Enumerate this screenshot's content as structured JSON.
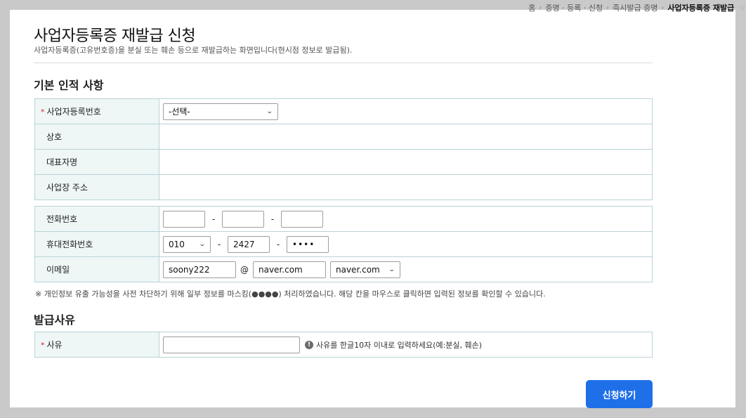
{
  "breadcrumb": {
    "home": "홈",
    "level1": "증명 · 등록 · 신청",
    "level2": "즉시발급 증명",
    "current": "사업자등록증 재발급"
  },
  "page": {
    "title": "사업자등록증 재발급 신청",
    "description": "사업자등록증(고유번호증)을 분실 또는 훼손 등으로 재발급하는 화면입니다(현시점 정보로 발급됨)."
  },
  "basic_info": {
    "section_title": "기본 인적 사항",
    "reg_number_label": "사업자등록번호",
    "reg_number_value": "-선택-",
    "company_label": "상호",
    "company_value": "",
    "ceo_label": "대표자명",
    "ceo_value": "",
    "address_label": "사업장 주소",
    "address_value": ""
  },
  "contact": {
    "phone_label": "전화번호",
    "phone": [
      "",
      "",
      ""
    ],
    "mobile_label": "휴대전화번호",
    "mobile_prefix": "010",
    "mobile_middle": "2427",
    "mobile_last": "••••",
    "email_label": "이메일",
    "email_id": "soony222",
    "email_at": "@",
    "email_domain": "naver.com",
    "email_domain_select": "naver.com",
    "separator": "-"
  },
  "notice": "※ 개인정보 유출 가능성을 사전 차단하기 위해 일부 정보를 마스킹(●●●●) 처리하였습니다. 해당 칸을 마우스로 클릭하면 입력된 정보를 확인할 수 있습니다.",
  "reason": {
    "section_title": "발급사유",
    "label": "사유",
    "value": "",
    "hint": "사유를 한글10자 이내로 입력하세요(예:분실, 훼손)"
  },
  "required_mark": "*",
  "submit_label": "신청하기",
  "icons": {
    "breadcrumb_separator": "chevron-right-icon",
    "dropdown": "chevron-down-icon",
    "hint": "exclamation-circle-icon",
    "favorite": "star-icon"
  }
}
